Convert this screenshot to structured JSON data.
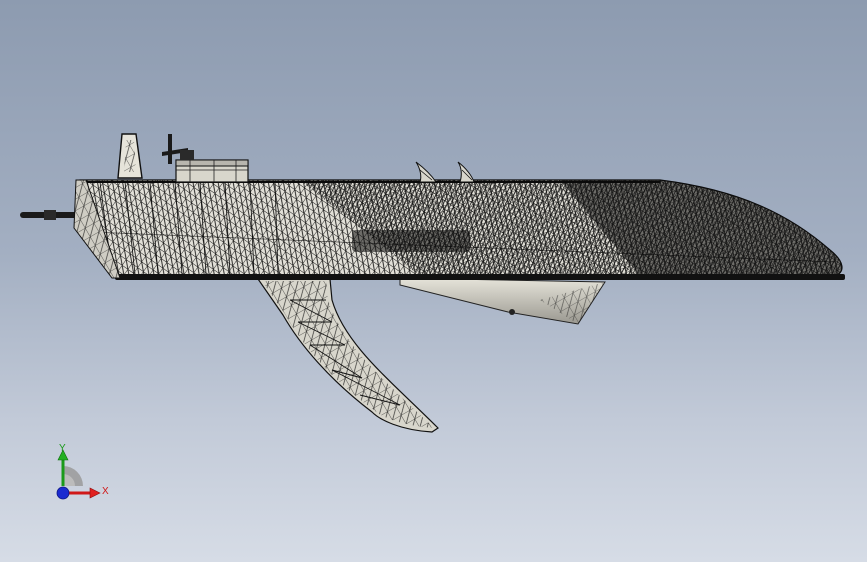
{
  "viewport": {
    "background_top": "#8d9bb0",
    "background_bottom": "#d6dce6"
  },
  "model": {
    "mesh_color": "#141414",
    "face_color": "#d8d6cc",
    "part_name": "hydrofoil-boat-hull"
  },
  "triad": {
    "x_label": "X",
    "y_label": "Y",
    "x_color": "#d01818",
    "y_color": "#1a9a1a",
    "z_color": "#1a2ad0"
  }
}
